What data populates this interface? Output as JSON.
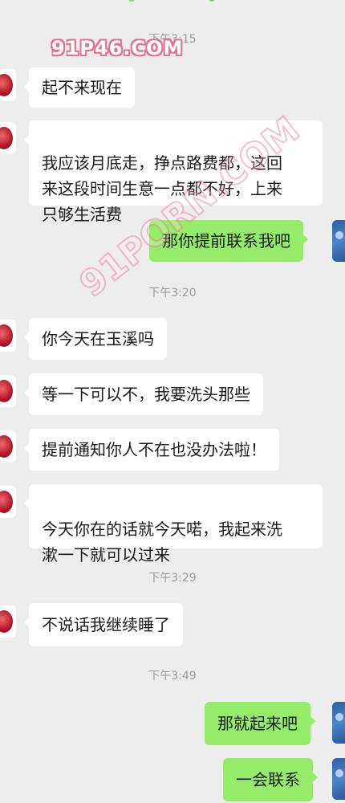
{
  "timestamps": [
    "下午3:15",
    "下午3:20",
    "下午3:29",
    "下午3:49"
  ],
  "messages": [
    {
      "side": "left",
      "text": "起不来现在"
    },
    {
      "side": "left",
      "text": "我应该月底走，挣点路费都，这回\n来这段时间生意一点都不好，上来\n只够生活费"
    },
    {
      "side": "right",
      "text": "那你提前联系我吧"
    },
    {
      "side": "left",
      "text": "你今天在玉溪吗"
    },
    {
      "side": "left",
      "text": "等一下可以不，我要洗头那些"
    },
    {
      "side": "left",
      "text": "提前通知你人不在也没办法啦！"
    },
    {
      "side": "left",
      "text": "今天你在的话就今天喏，我起来洗\n漱一下就可以过来"
    },
    {
      "side": "left",
      "text": "不说话我继续睡了"
    },
    {
      "side": "right",
      "text": "那就起来吧"
    },
    {
      "side": "right",
      "text": "一会联系"
    }
  ],
  "watermark": {
    "primary": "91P46.COM",
    "secondary": "91PORN.COM"
  },
  "colors": {
    "background": "#ededed",
    "incoming_bubble": "#ffffff",
    "outgoing_bubble": "#95ec69",
    "timestamp_text": "#9a9a9a"
  },
  "icons": {
    "incoming_avatar": "red-avatar-icon",
    "outgoing_avatar": "blue-avatar-icon"
  }
}
